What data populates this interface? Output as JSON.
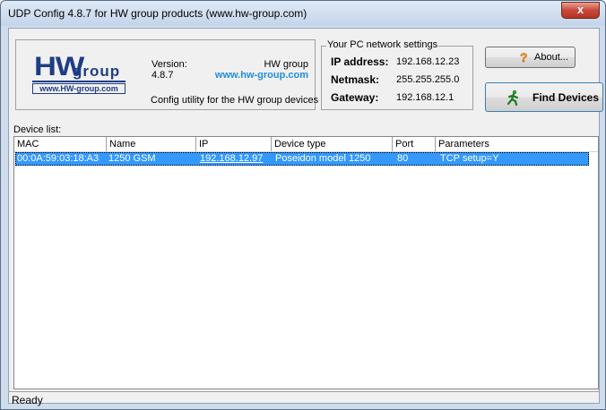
{
  "window": {
    "title": "UDP Config 4.8.7 for HW group products (www.hw-group.com)",
    "close_glyph": "x"
  },
  "logo": {
    "hw": "HW",
    "group": "group",
    "url": "www.HW-group.com",
    "brand_color": "#1e3d85"
  },
  "info": {
    "version_label": "Version:",
    "version_value": "4.8.7",
    "company": "HW group",
    "site": "www.hw-group.com",
    "tagline": "Config utility for the HW group devices"
  },
  "network": {
    "legend": "Your PC network settings",
    "ip_label": "IP address:",
    "ip_value": "192.168.12.23",
    "mask_label": "Netmask:",
    "mask_value": "255.255.255.0",
    "gw_label": "Gateway:",
    "gw_value": "192.168.12.1"
  },
  "buttons": {
    "about_label": "About...",
    "about_icon": "question-icon",
    "find_label": "Find Devices",
    "find_icon": "running-man-icon"
  },
  "device_list": {
    "label": "Device list:",
    "columns": [
      "MAC",
      "Name",
      "IP",
      "Device type",
      "Port",
      "Parameters"
    ],
    "rows": [
      {
        "mac": "00:0A:59:03:18:A3",
        "name": "1250 GSM",
        "ip": "192.168.12.97",
        "type": "Poseidon model 1250",
        "port": "80",
        "params": "TCP setup=Y"
      }
    ],
    "selection_color": "#3399ff"
  },
  "status": {
    "text": "Ready"
  }
}
